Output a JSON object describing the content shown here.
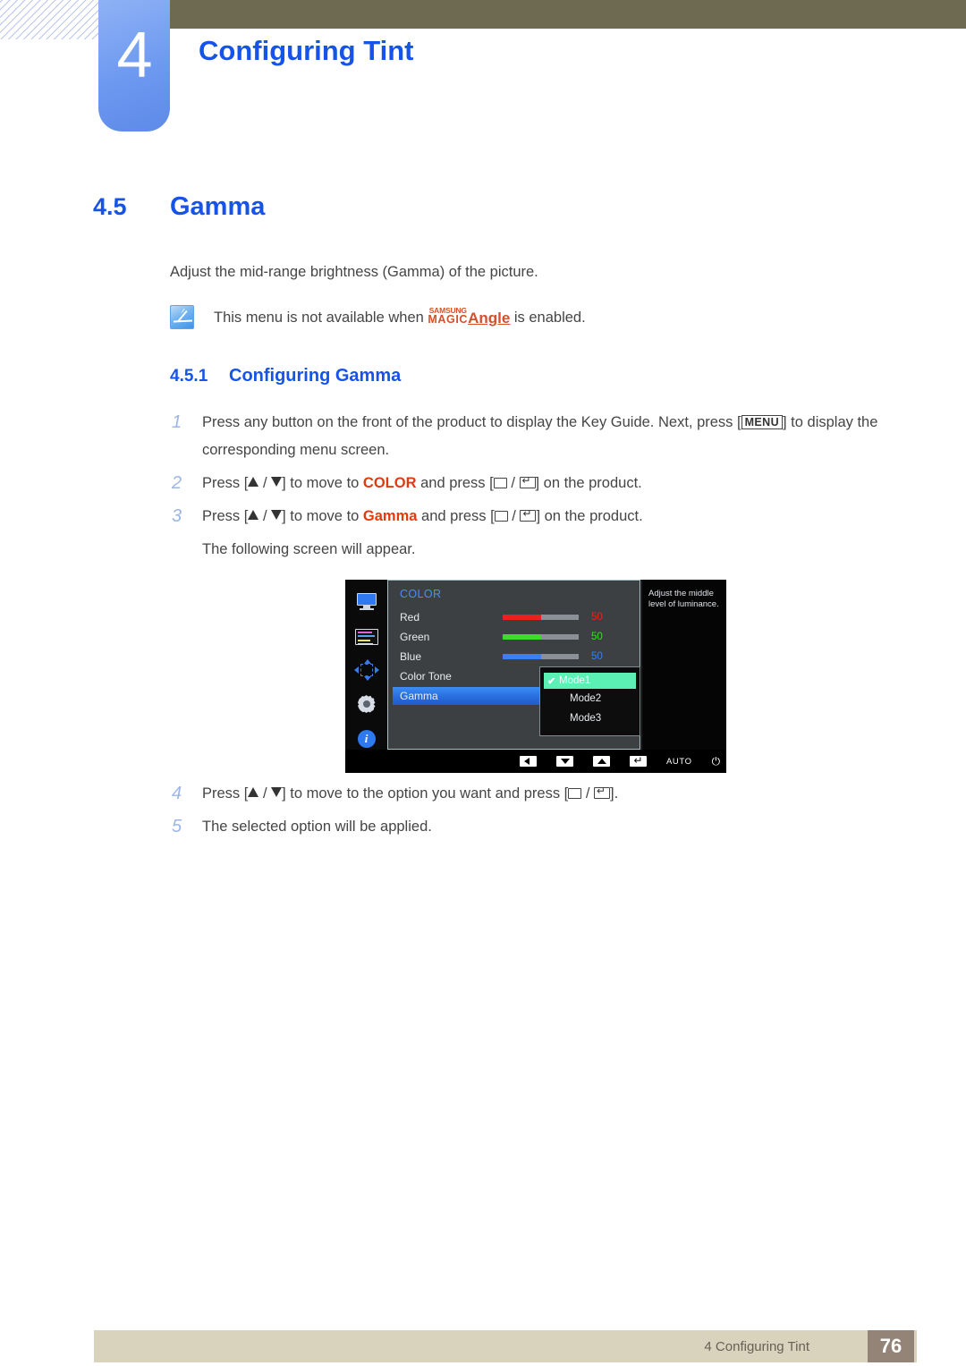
{
  "chapter": {
    "number": "4",
    "title": "Configuring Tint"
  },
  "section": {
    "number": "4.5",
    "title": "Gamma",
    "intro": "Adjust the mid-range brightness (Gamma) of the picture."
  },
  "note": {
    "icon": "note-pencil-icon",
    "text_before": "This menu is not available when ",
    "logo_top": "SAMSUNG",
    "logo_bottom": "MAGIC",
    "logo_word": "Angle",
    "text_after": " is enabled."
  },
  "subsection": {
    "number": "4.5.1",
    "title": "Configuring Gamma"
  },
  "steps": [
    {
      "num": "1",
      "parts": [
        {
          "t": "text",
          "v": "Press any button on the front of the product to display the Key Guide. Next, press ["
        },
        {
          "t": "key",
          "v": "MENU"
        },
        {
          "t": "text",
          "v": "] to display the corresponding menu screen."
        }
      ]
    },
    {
      "num": "2",
      "parts": [
        {
          "t": "text",
          "v": "Press ["
        },
        {
          "t": "arrow-up",
          "v": ""
        },
        {
          "t": "text",
          "v": " / "
        },
        {
          "t": "arrow-down",
          "v": ""
        },
        {
          "t": "text",
          "v": "] to move to "
        },
        {
          "t": "red",
          "v": "COLOR"
        },
        {
          "t": "text",
          "v": " and press ["
        },
        {
          "t": "icon-box",
          "v": ""
        },
        {
          "t": "text",
          "v": " / "
        },
        {
          "t": "icon-enter",
          "v": ""
        },
        {
          "t": "text",
          "v": "] on the product."
        }
      ]
    },
    {
      "num": "3",
      "parts": [
        {
          "t": "text",
          "v": "Press ["
        },
        {
          "t": "arrow-up",
          "v": ""
        },
        {
          "t": "text",
          "v": " / "
        },
        {
          "t": "arrow-down",
          "v": ""
        },
        {
          "t": "text",
          "v": "] to move to "
        },
        {
          "t": "red",
          "v": "Gamma"
        },
        {
          "t": "text",
          "v": " and press ["
        },
        {
          "t": "icon-box",
          "v": ""
        },
        {
          "t": "text",
          "v": " / "
        },
        {
          "t": "icon-enter",
          "v": ""
        },
        {
          "t": "text",
          "v": "] on the product."
        }
      ],
      "followup": "The following screen will appear."
    },
    {
      "num": "4",
      "parts": [
        {
          "t": "text",
          "v": "Press ["
        },
        {
          "t": "arrow-up",
          "v": ""
        },
        {
          "t": "text",
          "v": " / "
        },
        {
          "t": "arrow-down",
          "v": ""
        },
        {
          "t": "text",
          "v": "] to move to the option you want and press ["
        },
        {
          "t": "icon-box",
          "v": ""
        },
        {
          "t": "text",
          "v": " / "
        },
        {
          "t": "icon-enter",
          "v": ""
        },
        {
          "t": "text",
          "v": "]."
        }
      ]
    },
    {
      "num": "5",
      "parts": [
        {
          "t": "text",
          "v": "The selected option will be applied."
        }
      ]
    }
  ],
  "osd": {
    "menu_title": "COLOR",
    "sidebar_icons": [
      "monitor-icon",
      "color-bars-icon",
      "move-arrows-icon",
      "gear-icon",
      "info-icon"
    ],
    "rows": [
      {
        "label": "Red",
        "value": "50",
        "color": "#e8221d",
        "fill": 50,
        "selected": false
      },
      {
        "label": "Green",
        "value": "50",
        "color": "#3ddb2a",
        "fill": 50,
        "selected": false
      },
      {
        "label": "Blue",
        "value": "50",
        "color": "#3b7ff0",
        "fill": 50,
        "selected": false
      },
      {
        "label": "Color Tone",
        "value": "",
        "color": "",
        "fill": 0,
        "selected": false
      },
      {
        "label": "Gamma",
        "value": "",
        "color": "",
        "fill": 0,
        "selected": true
      }
    ],
    "dropdown": {
      "items": [
        "Mode1",
        "Mode2",
        "Mode3"
      ],
      "selected_index": 0,
      "check_glyph": "✔",
      "highlight_color": "#5bf0b4"
    },
    "help_text": "Adjust the middle level of luminance.",
    "bottom_bar": {
      "keys": [
        "left-arrow-key",
        "down-arrow-key",
        "up-arrow-key",
        "enter-key"
      ],
      "auto_label": "AUTO",
      "power_glyph": "⏻"
    }
  },
  "footer": {
    "text": "4 Configuring Tint",
    "page": "76"
  },
  "colors": {
    "heading_blue": "#1653e8",
    "accent_red": "#e03a11",
    "olive": "#6e6a52",
    "footer_tan": "#d9d2bd",
    "footer_page_box": "#938477",
    "tab_blue": "#6d99f0"
  }
}
